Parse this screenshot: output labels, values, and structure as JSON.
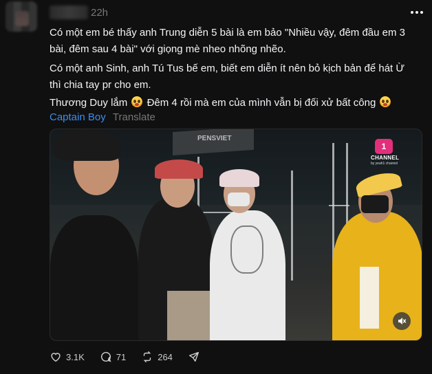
{
  "post": {
    "time": "22h",
    "paragraphs": {
      "p1": "Có một em bé thấy anh Trung diễn 5 bài là em bảo \"Nhiều vậy, đêm đầu em 3 bài, đêm sau 4 bài\" với giọng mè nheo nhõng nhẽo.",
      "p2": "Có một anh Sinh, anh Tú Tus bế em, biết em diễn ít nên bỏ kịch bản để hát Ừ thì chia tay pr cho em.",
      "p3a": "Thương Duy lắm",
      "p3b": "Đêm 4 rồi mà em của mình vẫn bị đối xử bất công"
    },
    "author_link": "Captain Boy",
    "translate": "Translate"
  },
  "video": {
    "channel_logo": "Yeah1",
    "channel_logo_mark": "1",
    "channel_name": "CHANNEL",
    "channel_sub": "by yeah1 channel",
    "banner_text": "PENSVIET"
  },
  "actions": {
    "likes": "3.1K",
    "comments": "71",
    "reposts": "264"
  },
  "icons": [
    "heart-icon",
    "comment-icon",
    "repost-icon",
    "share-icon",
    "more-icon",
    "mute-icon",
    "crying-face-emoji"
  ],
  "colors": {
    "background": "#101010",
    "text": "#f3f5f7",
    "link": "#3a8df5",
    "muted": "#777777"
  }
}
